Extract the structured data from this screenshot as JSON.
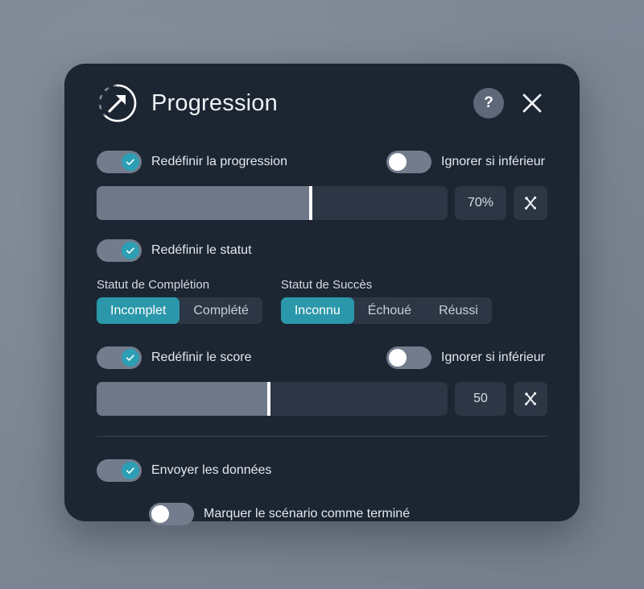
{
  "dialog": {
    "title": "Progression",
    "title_icon": "progress-arrow-icon",
    "help_label": "?",
    "close_label": "✕"
  },
  "progress_section": {
    "reset_toggle": {
      "label": "Redéfinir la progression",
      "checked": true
    },
    "ignore_toggle": {
      "label": "Ignorer si inférieur",
      "checked": false
    },
    "slider": {
      "value": 70,
      "display": "70%",
      "fill_percent": 61
    },
    "variable_icon": "variable-icon"
  },
  "status_section": {
    "reset_toggle": {
      "label": "Redéfinir le statut",
      "checked": true
    },
    "completion": {
      "caption": "Statut de Complétion",
      "options": [
        "Incomplet",
        "Complété"
      ],
      "selected": "Incomplet"
    },
    "success": {
      "caption": "Statut de Succès",
      "options": [
        "Inconnu",
        "Échoué",
        "Réussi"
      ],
      "selected": "Inconnu"
    }
  },
  "score_section": {
    "reset_toggle": {
      "label": "Redéfinir le score",
      "checked": true
    },
    "ignore_toggle": {
      "label": "Ignorer si inférieur",
      "checked": false
    },
    "slider": {
      "value": 50,
      "display": "50",
      "fill_percent": 49
    },
    "variable_icon": "variable-icon"
  },
  "data_section": {
    "send_toggle": {
      "label": "Envoyer les données",
      "checked": true
    },
    "complete_toggle": {
      "label": "Marquer le scénario comme terminé",
      "checked": false
    }
  },
  "colors": {
    "panel_bg": "#1c2532",
    "backdrop": "#7d8794",
    "accent_teal": "#2b97aa",
    "knob_teal": "#2d9fb4",
    "control_bg": "#2d3644",
    "slider_fill": "#6e7888",
    "track_gray": "#727c8c"
  }
}
